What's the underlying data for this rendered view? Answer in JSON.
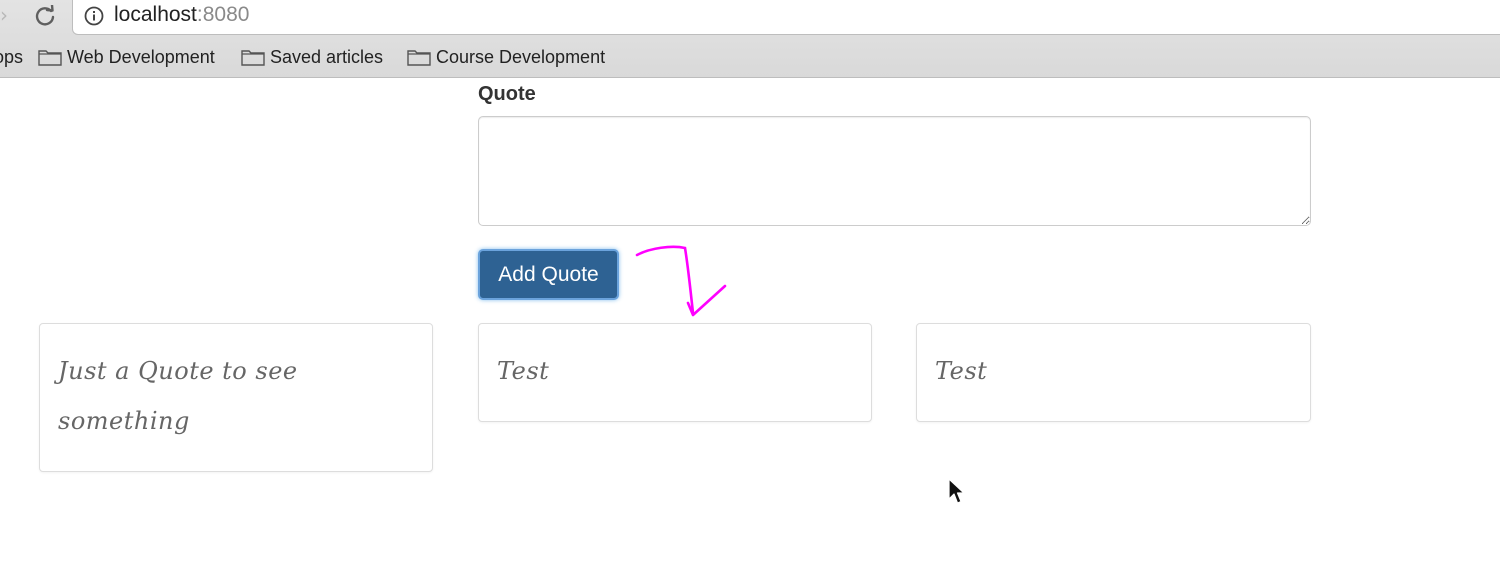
{
  "browser": {
    "forward_icon": "forward-arrow-icon",
    "reload_icon": "reload-icon",
    "address": {
      "host": "localhost",
      "port": ":8080",
      "info_icon": "info-icon"
    },
    "bookmarks": [
      {
        "label": "ops",
        "has_icon": false
      },
      {
        "label": "Web Development",
        "has_icon": true
      },
      {
        "label": "Saved articles",
        "has_icon": true
      },
      {
        "label": "Course Development",
        "has_icon": true
      }
    ]
  },
  "form": {
    "label": "Quote",
    "textarea_value": "",
    "button_label": "Add Quote"
  },
  "quotes": [
    {
      "text": "Just a Quote to see something"
    },
    {
      "text": "Test"
    },
    {
      "text": "Test"
    }
  ],
  "colors": {
    "button": "#2e6293",
    "annotation": "#ff00ff",
    "quote_text": "#666666"
  }
}
